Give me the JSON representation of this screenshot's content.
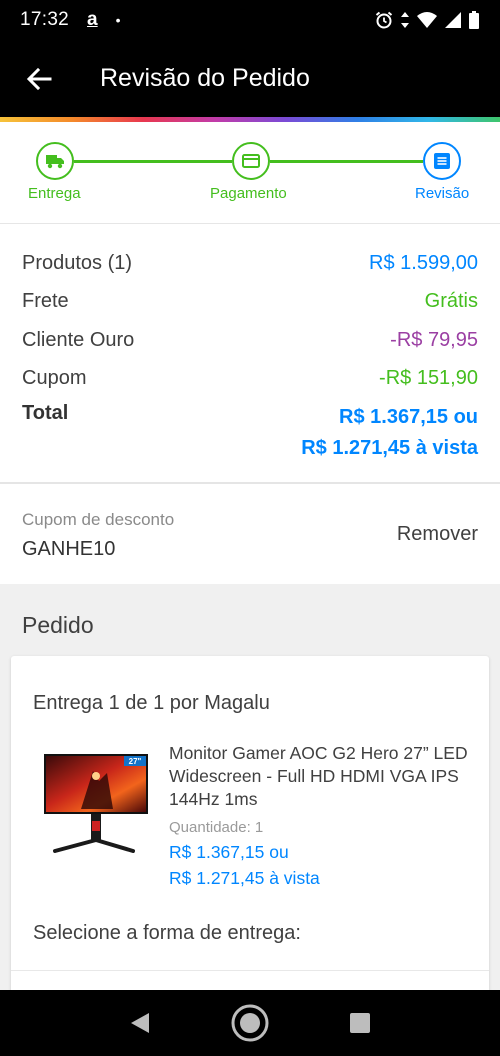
{
  "status_bar": {
    "time": "17:32",
    "app_icon": "a",
    "dot": "•"
  },
  "app_bar": {
    "title": "Revisão do Pedido"
  },
  "stepper": {
    "steps": [
      {
        "label": "Entrega",
        "icon": "truck-icon",
        "state": "done"
      },
      {
        "label": "Pagamento",
        "icon": "card-icon",
        "state": "done"
      },
      {
        "label": "Revisão",
        "icon": "list-icon",
        "state": "current"
      }
    ],
    "colors": {
      "done": "#44be1e",
      "current": "#0086ff"
    }
  },
  "summary": {
    "products_label": "Produtos (1)",
    "products_value": "R$ 1.599,00",
    "shipping_label": "Frete",
    "shipping_value": "Grátis",
    "gold_label": "Cliente Ouro",
    "gold_value": "-R$ 79,95",
    "coupon_label": "Cupom",
    "coupon_value": "-R$ 151,90",
    "total_label": "Total",
    "total_value_line1": "R$ 1.367,15 ou",
    "total_value_line2": "R$ 1.271,45 à vista"
  },
  "coupon": {
    "label": "Cupom de desconto",
    "code": "GANHE10",
    "remove_label": "Remover"
  },
  "order": {
    "title": "Pedido",
    "delivery_heading": "Entrega 1 de 1 por Magalu",
    "product": {
      "name": "Monitor Gamer AOC G2 Hero 27” LED Widescreen - Full HD HDMI VGA IPS 144Hz 1ms",
      "quantity": "Quantidade:  1",
      "price_line1": "R$ 1.367,15 ou",
      "price_line2": "R$ 1.271,45 à vista",
      "image_badge": "27\""
    },
    "select_delivery": "Selecione a forma de entrega:"
  }
}
